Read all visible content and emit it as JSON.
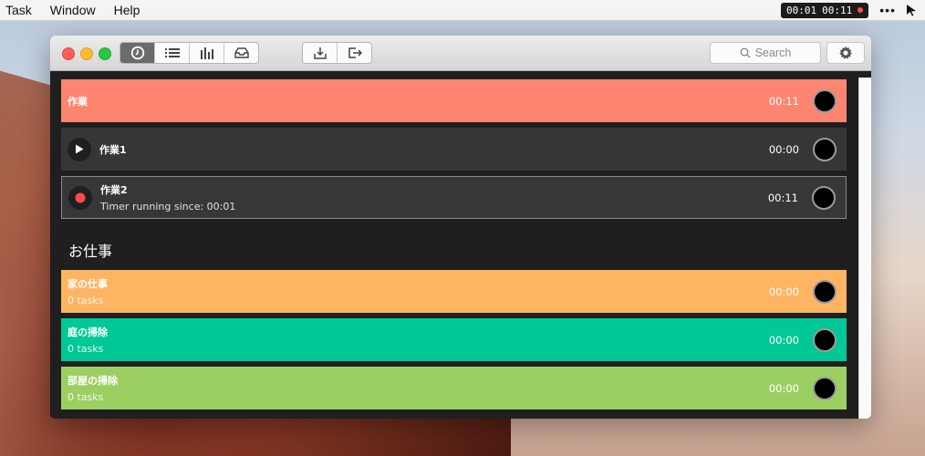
{
  "menubar": {
    "menus": [
      "Task",
      "Window",
      "Help"
    ],
    "timer_total": "00:01",
    "timer_current": "00:11",
    "dots": "•••"
  },
  "toolbar": {
    "search_placeholder": "Search"
  },
  "colors": {
    "salmon": "#fe8671",
    "orange": "#feb562",
    "teal": "#00c896",
    "lime": "#9ccf62",
    "dark_row": "#363636",
    "record_red": "#ff4b4b"
  },
  "tasks": [
    {
      "title": "作業",
      "subtitle": "",
      "time": "00:11",
      "style": "salmon"
    },
    {
      "title": "作業1",
      "subtitle": "",
      "time": "00:00",
      "style": "dark",
      "icon": "play-icon"
    },
    {
      "title": "作業2",
      "subtitle": "Timer running since: 00:01",
      "time": "00:11",
      "style": "dark-selected",
      "icon": "record-icon"
    }
  ],
  "section": {
    "title": "お仕事",
    "projects": [
      {
        "title": "家の仕事",
        "subtitle": "0 tasks",
        "time": "00:00",
        "style": "orange"
      },
      {
        "title": "庭の掃除",
        "subtitle": "0 tasks",
        "time": "00:00",
        "style": "teal"
      },
      {
        "title": "部屋の掃除",
        "subtitle": "0 tasks",
        "time": "00:00",
        "style": "lime"
      }
    ]
  }
}
